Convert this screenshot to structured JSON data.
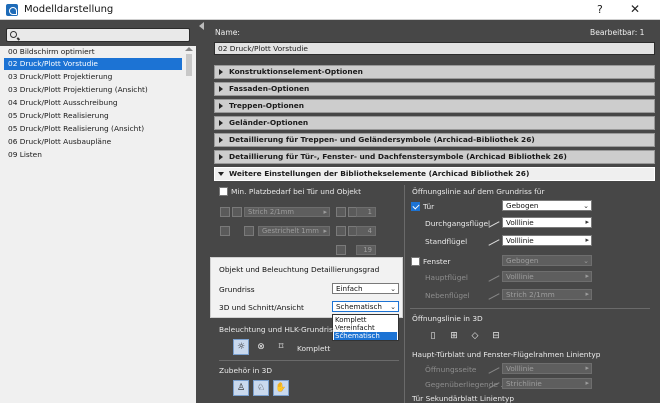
{
  "window": {
    "title": "Modelldarstellung",
    "help": "?",
    "close": "✕"
  },
  "left": {
    "search_placeholder": "",
    "items": [
      {
        "label": "00 Bildschirm optimiert",
        "selected": false
      },
      {
        "label": "02 Druck/Plott Vorstudie",
        "selected": true
      },
      {
        "label": "03 Druck/Plott Projektierung",
        "selected": false
      },
      {
        "label": "03 Druck/Plott Projektierung (Ansicht)",
        "selected": false
      },
      {
        "label": "04 Druck/Plott Ausschreibung",
        "selected": false
      },
      {
        "label": "05 Druck/Plott Realisierung",
        "selected": false
      },
      {
        "label": "05 Druck/Plott Realisierung (Ansicht)",
        "selected": false
      },
      {
        "label": "06 Druck/Plott Ausbaupläne",
        "selected": false
      },
      {
        "label": "09 Listen",
        "selected": false
      }
    ]
  },
  "right": {
    "name_label": "Name:",
    "editable_label": "Bearbeitbar: 1",
    "name_value": "02 Druck/Plott Vorstudie",
    "sections": [
      {
        "label": "Konstruktionselement-Optionen",
        "open": false
      },
      {
        "label": "Fassaden-Optionen",
        "open": false
      },
      {
        "label": "Treppen-Optionen",
        "open": false
      },
      {
        "label": "Geländer-Optionen",
        "open": false
      },
      {
        "label": "Detaillierung für Treppen- und Geländersymbole (Archicad-Bibliothek 26)",
        "open": false
      },
      {
        "label": "Detaillierung für Tür-, Fenster- und Dachfenstersymbole (Archicad Bibliothek 26)",
        "open": false
      },
      {
        "label": "Weitere Einstellungen der Bibliothekselemente (Archicad Bibliothek 26)",
        "open": true
      }
    ]
  },
  "settings": {
    "min_frame": "Min. Platzbedarf bei Tür und Objekt",
    "pen_stroke": "Strich 2/1mm",
    "pen_dashed": "Gestrichelt 1mm",
    "num_1": "1",
    "num_4": "4",
    "num_19": "19",
    "popup": {
      "title": "Objekt und Beleuchtung Detaillierungsgrad",
      "grundriss_label": "Grundriss",
      "grundriss_value": "Einfach",
      "3d_label": "3D und Schnitt/Ansicht",
      "3d_value": "Schematisch",
      "options": [
        "Komplett",
        "Vereinfacht",
        "Schematisch"
      ],
      "selected_option": "Schematisch"
    },
    "lighting_label": "Beleuchtung und HLK-Grundrisssym",
    "lighting_value": "Komplett",
    "zubehoer_label": "Zubehör in 3D",
    "opening_title": "Öffnungslinie auf dem Grundriss für",
    "door_label": "Tür",
    "door_value": "Gebogen",
    "pass_wing_label": "Durchgangsflügel",
    "pass_wing_value": "Volllinie",
    "fixed_wing_label": "Standflügel",
    "fixed_wing_value": "Volllinie",
    "window_label": "Fenster",
    "window_value": "Gebogen",
    "main_wing_label": "Hauptflügel",
    "main_wing_value": "Volllinie",
    "side_wing_label": "Nebenflügel",
    "side_wing_value": "Strich 2/1mm",
    "opening_3d_title": "Öffnungslinie in 3D",
    "frame_title": "Haupt-Türblatt und Fenster-Flügelrahmen Linientyp",
    "opening_side_label": "Öffnungsseite",
    "opening_side_value": "Volllinie",
    "opposite_label": "Gegenüberliegende ...",
    "opposite_value": "Strichlinie",
    "secondary_title": "Tür Sekundärblatt Linientyp"
  }
}
